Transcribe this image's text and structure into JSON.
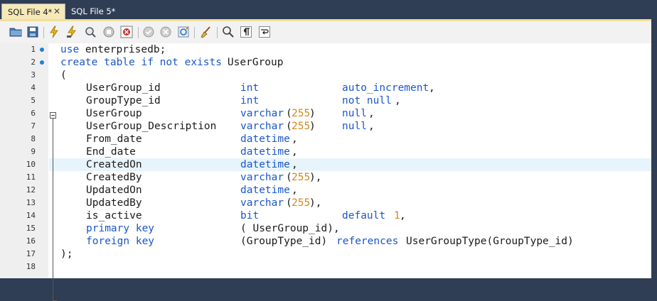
{
  "tabs": [
    {
      "label": "SQL File 4*",
      "close": "✕"
    },
    {
      "label": "SQL File 5*"
    }
  ],
  "toolbar_icons": [
    "open-folder-icon",
    "save-icon",
    "execute-icon",
    "execute-current-icon",
    "explain-icon",
    "stop-icon",
    "toggle-error-icon",
    "commit-icon",
    "rollback-icon",
    "autocommit-icon",
    "beautify-icon",
    "find-icon",
    "invisible-chars-icon",
    "wrap-icon"
  ],
  "lines": [
    {
      "n": "1",
      "dot": true,
      "tokens": [
        {
          "t": "use",
          "k": "kw"
        },
        {
          "t": " enterprisedb;"
        }
      ]
    },
    {
      "n": "2",
      "dot": true,
      "tokens": [
        {
          "t": "create table if not exists",
          "k": "kw"
        },
        {
          "t": " UserGroup"
        }
      ]
    },
    {
      "n": "3",
      "tokens": [
        {
          "t": "("
        }
      ]
    },
    {
      "n": "4",
      "tokens": [
        {
          "t": "UserGroup_id",
          "c": 1
        },
        {
          "t": "int",
          "k": "kw",
          "c": 2
        },
        {
          "t": "auto_increment",
          "k": "kw",
          "c": 3
        },
        {
          "t": ",",
          "c": 4
        }
      ]
    },
    {
      "n": "5",
      "tokens": [
        {
          "t": "GroupType_id",
          "c": 1
        },
        {
          "t": "int",
          "k": "kw",
          "c": 2
        },
        {
          "t": "not null",
          "k": "kw",
          "c": 3
        },
        {
          "t": ",",
          "c": 5
        }
      ]
    },
    {
      "n": "6",
      "tokens": [
        {
          "t": "UserGroup",
          "c": 1
        },
        {
          "t": "varchar",
          "k": "kw",
          "c": 2
        },
        {
          "t": "(",
          "c": 6
        },
        {
          "t": "255",
          "k": "num",
          "c": 7
        },
        {
          "t": ")",
          "c": 8
        },
        {
          "t": "null",
          "k": "kw",
          "c": 3
        },
        {
          "t": ",",
          "c": 9
        }
      ]
    },
    {
      "n": "7",
      "tokens": [
        {
          "t": "UserGroup_Description",
          "c": 1
        },
        {
          "t": "varchar",
          "k": "kw",
          "c": 2
        },
        {
          "t": "(",
          "c": 6
        },
        {
          "t": "255",
          "k": "num",
          "c": 7
        },
        {
          "t": ")",
          "c": 8
        },
        {
          "t": "null",
          "k": "kw",
          "c": 3
        },
        {
          "t": ",",
          "c": 9
        }
      ]
    },
    {
      "n": "8",
      "tokens": [
        {
          "t": "From_date",
          "c": 1
        },
        {
          "t": "datetime",
          "k": "kw",
          "c": 2
        },
        {
          "t": ",",
          "c": 10
        }
      ]
    },
    {
      "n": "9",
      "tokens": [
        {
          "t": "End_date",
          "c": 1
        },
        {
          "t": "datetime",
          "k": "kw",
          "c": 2
        },
        {
          "t": ",",
          "c": 10
        }
      ]
    },
    {
      "n": "10",
      "cur": true,
      "tokens": [
        {
          "t": "CreatedOn",
          "c": 1
        },
        {
          "t": "datetime",
          "k": "kw",
          "c": 2
        },
        {
          "t": ",",
          "c": 10
        }
      ]
    },
    {
      "n": "11",
      "tokens": [
        {
          "t": "CreatedBy",
          "c": 1
        },
        {
          "t": "varchar",
          "k": "kw",
          "c": 2
        },
        {
          "t": "(",
          "c": 6
        },
        {
          "t": "255",
          "k": "num",
          "c": 7
        },
        {
          "t": "),",
          "c": 8
        }
      ]
    },
    {
      "n": "12",
      "tokens": [
        {
          "t": "UpdatedOn",
          "c": 1
        },
        {
          "t": "datetime",
          "k": "kw",
          "c": 2
        },
        {
          "t": ",",
          "c": 10
        }
      ]
    },
    {
      "n": "13",
      "tokens": [
        {
          "t": "UpdatedBy",
          "c": 1
        },
        {
          "t": "varchar",
          "k": "kw",
          "c": 2
        },
        {
          "t": "(",
          "c": 6
        },
        {
          "t": "255",
          "k": "num",
          "c": 7
        },
        {
          "t": "),",
          "c": 8
        }
      ]
    },
    {
      "n": "14",
      "tokens": [
        {
          "t": "is_active",
          "c": 1
        },
        {
          "t": "bit",
          "k": "kw",
          "c": 2
        },
        {
          "t": "default",
          "k": "kw",
          "c": 3
        },
        {
          "t": "1",
          "k": "num",
          "c": 11
        },
        {
          "t": ",",
          "c": 12
        }
      ]
    },
    {
      "n": "15",
      "tokens": [
        {
          "t": "primary key",
          "k": "kw",
          "c": 1
        },
        {
          "t": "( UserGroup_id),",
          "c": 2
        }
      ]
    },
    {
      "n": "16",
      "tokens": [
        {
          "t": "foreign key",
          "k": "kw",
          "c": 1
        },
        {
          "t": "(GroupType_id)",
          "c": 2
        },
        {
          "t": "references",
          "k": "kw",
          "c": 13
        },
        {
          "t": "UserGroupType(GroupType_id)",
          "c": 14
        }
      ]
    },
    {
      "n": "17",
      "tokens": [
        {
          "t": ");"
        }
      ]
    },
    {
      "n": "18",
      "tokens": []
    }
  ]
}
